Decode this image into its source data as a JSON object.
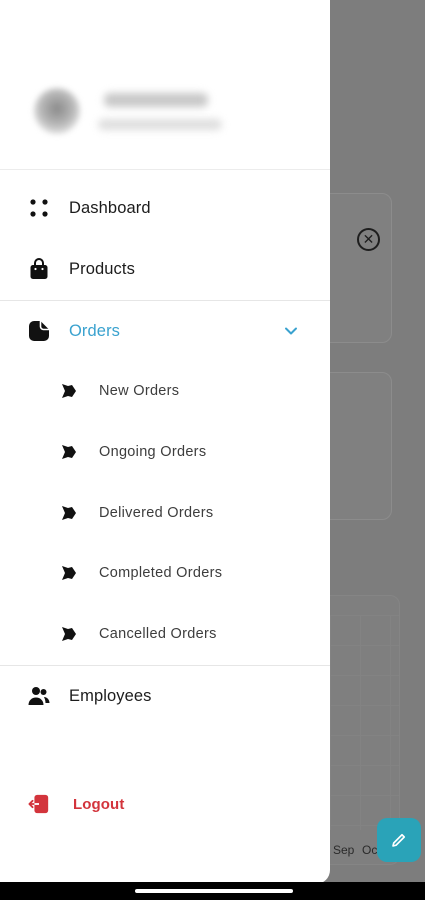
{
  "drawer": {
    "nav_items": [
      {
        "label": "Dashboard",
        "icon": "grid-dots-icon"
      },
      {
        "label": "Products",
        "icon": "shopping-bag-icon"
      },
      {
        "label": "Orders",
        "icon": "document-icon",
        "expanded": true,
        "active_color": "#3aa2cf"
      },
      {
        "label": "Employees",
        "icon": "users-icon"
      }
    ],
    "orders_sub_items": [
      {
        "label": "New Orders",
        "icon": "order-status-icon"
      },
      {
        "label": "Ongoing Orders",
        "icon": "order-status-icon"
      },
      {
        "label": "Delivered Orders",
        "icon": "order-status-icon"
      },
      {
        "label": "Completed Orders",
        "icon": "order-status-icon"
      },
      {
        "label": "Cancelled Orders",
        "icon": "order-status-icon"
      }
    ],
    "logout": {
      "label": "Logout",
      "icon": "logout-icon",
      "color": "#d3343c"
    }
  },
  "background": {
    "chart_axis_labels": [
      "Sep",
      "Oc"
    ],
    "fab_icon": "pencil-icon",
    "close_icon": "close-circle-icon",
    "accent": "#2aa3b8"
  }
}
